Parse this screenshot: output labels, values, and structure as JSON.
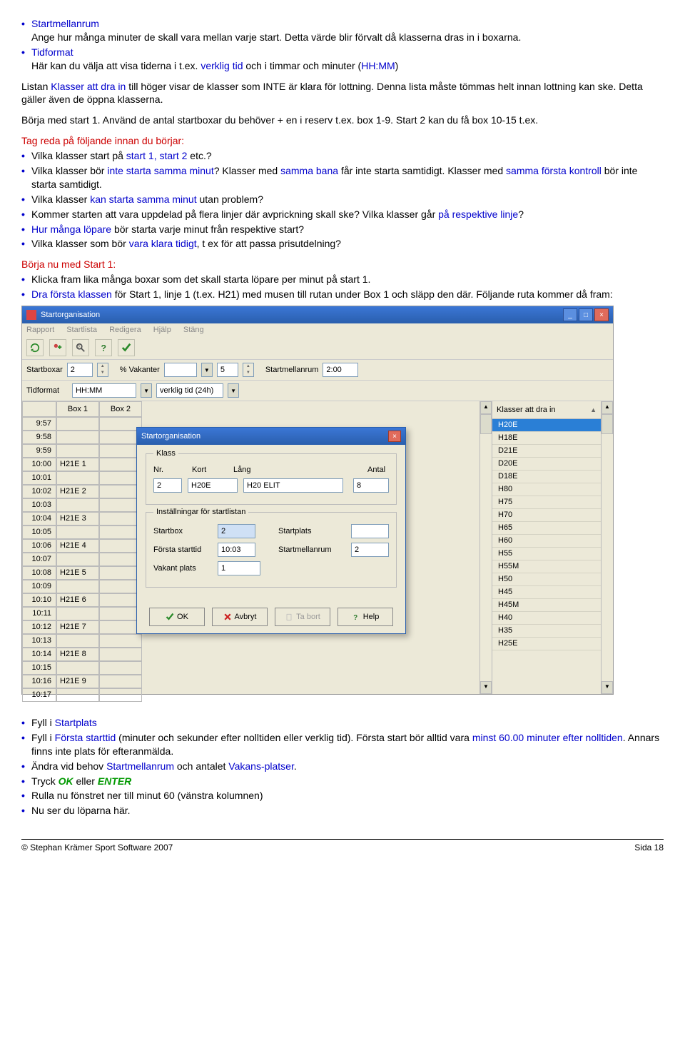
{
  "para1": {
    "startmellanrum": "Startmellanrum",
    "angehur": "Ange hur många minuter de skall vara mellan varje start. Detta värde blir förvalt då klasserna dras in i boxarna.",
    "tidformat": "Tidformat",
    "harkan_pre": "Här kan du välja att visa tiderna i t.ex. ",
    "verklig": "verklig tid",
    "harkan_mid": " och i timmar och minuter (",
    "hhmm": "HH:MM",
    "harkan_end": ")"
  },
  "para2": {
    "listan_pre": "Listan ",
    "klasser": "Klasser att dra in",
    "listan_rest": " till höger visar de klasser som INTE är klara för lottning. Denna lista måste tömmas helt innan lottning kan ske. Detta gäller även de öppna klasserna."
  },
  "para3": "Börja med start 1. Använd de antal startboxar du behöver + en i reserv t.ex. box 1-9. Start 2 kan du få box 10-15 t.ex.",
  "listA": {
    "heading": "Tag reda på följande innan du börjar:",
    "it1_pre": "Vilka klasser start på ",
    "it1_span": "start 1, start 2",
    "it1_post": " etc.?",
    "it2_pre": "Vilka klasser bör ",
    "it2_span1": "inte starta samma minut",
    "it2_mid1": "? Klasser med ",
    "it2_span2": "samma bana",
    "it2_mid2": " får inte starta samtidigt. Klasser med ",
    "it2_span3": "samma första kontroll",
    "it2_post": " bör inte starta samtidigt.",
    "it3_pre": "Vilka klasser ",
    "it3_span": "kan starta samma minut",
    "it3_post": " utan problem?",
    "it4_pre": "Kommer starten att vara uppdelad på flera linjer där avprickning skall ske? Vilka klasser går ",
    "it4_span": "på respektive linje",
    "it4_post": "?",
    "it5_span": "Hur många löpare",
    "it5_post": " bör starta varje minut från respektive start?",
    "it6_pre": "Vilka klasser som bör ",
    "it6_span": "vara klara tidigt",
    "it6_post": ", t ex för att passa prisutdelning?"
  },
  "listB": {
    "heading": "Börja nu med Start 1:",
    "it1": "Klicka fram lika många boxar som det skall starta löpare per minut på start 1.",
    "it2_span": "Dra första klassen",
    "it2_post": " för Start 1, linje 1 (t.ex. H21) med musen till rutan under Box 1 och släpp den där. Följande ruta kommer då fram:"
  },
  "listC": {
    "it1_pre": "Fyll i ",
    "it1_span": "Startplats",
    "it2_pre": "Fyll i ",
    "it2_span": "Första starttid",
    "it2_mid": " (minuter och sekunder efter nolltiden eller verklig tid). Första start bör alltid vara ",
    "it2_span2": "minst 60.00 minuter efter nolltiden",
    "it2_post": ". Annars finns inte plats för efteranmälda.",
    "it3_pre": "Ändra vid behov ",
    "it3_span1": "Startmellanrum",
    "it3_mid": " och antalet ",
    "it3_span2": "Vakans-platser",
    "it3_post": ".",
    "it4_pre": "Tryck ",
    "it4_ok": "OK",
    "it4_mid": " eller ",
    "it4_enter": "ENTER",
    "it5": "Rulla nu fönstret ner till minut 60 (vänstra kolumnen)",
    "it6": "Nu ser du löparna här."
  },
  "sc": {
    "title": "Startorganisation",
    "menu": [
      "Rapport",
      "Startlista",
      "Redigera",
      "Hjälp",
      "Stäng"
    ],
    "fields": {
      "startboxar": "Startboxar",
      "startboxar_val": "2",
      "vakanter": "% Vakanter",
      "vakanter_val": "5",
      "startmellanrum": "Startmellanrum",
      "startmellanrum_val": "2:00",
      "tidformat": "Tidformat",
      "tidformat_val": "HH:MM",
      "verklig": "verklig tid (24h)"
    },
    "box1": "Box 1",
    "box2": "Box 2",
    "right_header": "Klasser att dra in",
    "right_items": [
      "H20E",
      "H18E",
      "D21E",
      "D20E",
      "D18E",
      "H80",
      "H75",
      "H70",
      "H65",
      "H60",
      "H55",
      "H55M",
      "H50",
      "H45",
      "H45M",
      "H40",
      "H35",
      "H25E"
    ],
    "times": [
      "9:57",
      "9:58",
      "9:59",
      "10:00",
      "10:01",
      "10:02",
      "10:03",
      "10:04",
      "10:05",
      "10:06",
      "10:07",
      "10:08",
      "10:09",
      "10:10",
      "10:11",
      "10:12",
      "10:13",
      "10:14",
      "10:15",
      "10:16",
      "10:17"
    ],
    "box1_cells": [
      "",
      "",
      "",
      "H21E  1",
      "",
      "H21E  2",
      "",
      "H21E  3",
      "",
      "H21E  4",
      "",
      "H21E  5",
      "",
      "H21E  6",
      "",
      "H21E  7",
      "",
      "H21E  8",
      "",
      "H21E  9",
      ""
    ],
    "dlg": {
      "title": "Startorganisation",
      "klass": "Klass",
      "nr": "Nr.",
      "kort": "Kort",
      "lang": "Lång",
      "antal": "Antal",
      "nr_val": "2",
      "kort_val": "H20E",
      "lang_val": "H20 ELIT",
      "antal_val": "8",
      "inst": "Inställningar för startlistan",
      "startbox": "Startbox",
      "startbox_val": "2",
      "startplats": "Startplats",
      "forsta": "Första starttid",
      "forsta_val": "10:03",
      "startmellan": "Startmellanrum",
      "startmellan_val": "2",
      "vakant": "Vakant plats",
      "vakant_val": "1",
      "ok": "OK",
      "avbryt": "Avbryt",
      "tabort": "Ta bort",
      "help": "Help"
    }
  },
  "footer": {
    "left": "© Stephan Krämer Sport Software 2007",
    "right": "Sida 18"
  }
}
